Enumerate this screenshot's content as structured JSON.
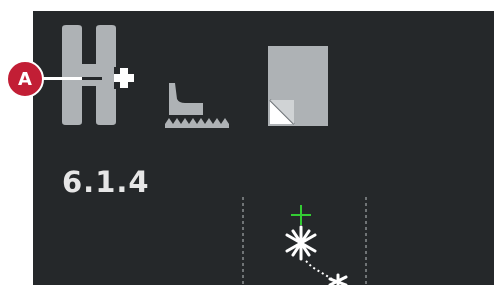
{
  "callout": {
    "label": "A"
  },
  "toolbar": {
    "presser_foot_button": {
      "icon": "presser-foot-add-icon"
    },
    "feed_dogs_button": {
      "icon": "feed-dogs-icon"
    },
    "stabilizer_button": {
      "icon": "stabilizer-icon"
    }
  },
  "stitch": {
    "id": "6.1.4"
  },
  "preview": {
    "needle_marker_color": "#33cc33",
    "stitch_color": "#ffffff"
  }
}
